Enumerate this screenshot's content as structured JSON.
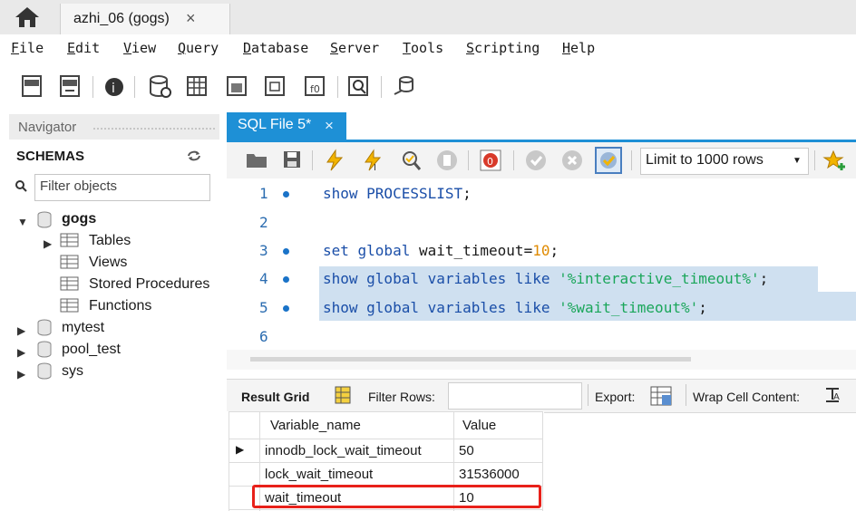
{
  "tabs": {
    "connection_label": "azhi_06 (gogs)",
    "close_glyph": "×"
  },
  "menu": [
    "File",
    "Edit",
    "View",
    "Query",
    "Database",
    "Server",
    "Tools",
    "Scripting",
    "Help"
  ],
  "navigator": {
    "title": "Navigator",
    "schemas_label": "SCHEMAS",
    "filter_placeholder": "Filter objects",
    "schemas": [
      {
        "name": "gogs",
        "expanded": true,
        "children": [
          "Tables",
          "Views",
          "Stored Procedures",
          "Functions"
        ]
      },
      {
        "name": "mytest"
      },
      {
        "name": "pool_test"
      },
      {
        "name": "sys"
      }
    ]
  },
  "editor": {
    "tab_label": "SQL File 5*",
    "limit_label": "Limit to 1000 rows",
    "lines": [
      {
        "num": "1",
        "parts": [
          [
            "kw",
            "show PROCESSLIST"
          ],
          [
            "pn",
            ";"
          ]
        ]
      },
      {
        "num": "2",
        "parts": []
      },
      {
        "num": "3",
        "parts": [
          [
            "kw",
            "set global "
          ],
          [
            "id",
            "wait_timeout"
          ],
          [
            "pn",
            "="
          ],
          [
            "nm",
            "10"
          ],
          [
            "pn",
            ";"
          ]
        ]
      },
      {
        "num": "4",
        "parts": [
          [
            "kw",
            "show global variables like "
          ],
          [
            "st",
            "'%interactive_timeout%'"
          ],
          [
            "pn",
            ";"
          ]
        ]
      },
      {
        "num": "5",
        "parts": [
          [
            "kw",
            "show global variables like "
          ],
          [
            "st",
            "'%wait_timeout%'"
          ],
          [
            "pn",
            ";"
          ]
        ]
      },
      {
        "num": "6",
        "parts": []
      }
    ]
  },
  "results": {
    "result_grid_label": "Result Grid",
    "filter_rows_label": "Filter Rows:",
    "export_label": "Export:",
    "wrap_label": "Wrap Cell Content:",
    "columns": [
      "Variable_name",
      "Value"
    ],
    "rows": [
      [
        "innodb_lock_wait_timeout",
        "50"
      ],
      [
        "lock_wait_timeout",
        "31536000"
      ],
      [
        "wait_timeout",
        "10"
      ]
    ]
  },
  "colors": {
    "accent": "#1e90d6",
    "keyword": "#1a4ea8",
    "string": "#1aa65a",
    "number": "#e08a00",
    "highlight": "#e8211a"
  }
}
